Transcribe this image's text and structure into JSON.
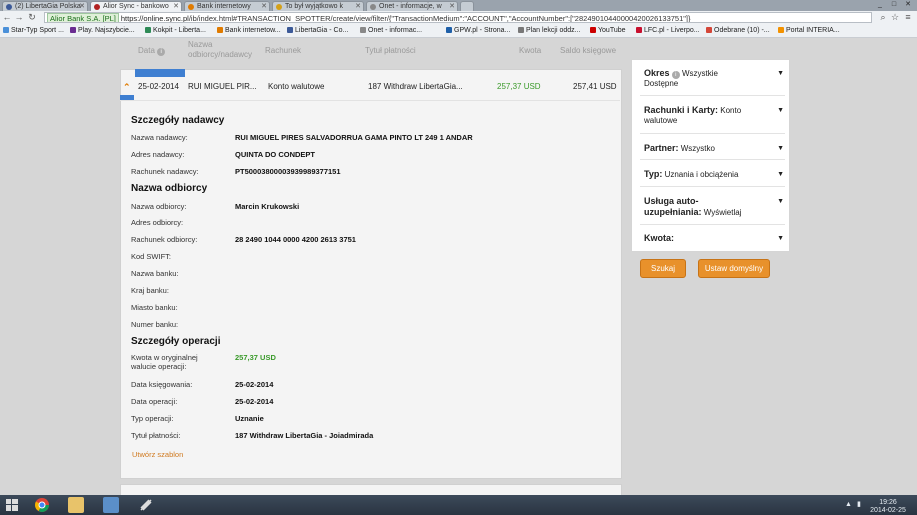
{
  "browser": {
    "tabs": [
      {
        "title": "(2) LibertaGia Polska",
        "color": "#3b5998"
      },
      {
        "title": "Alior Sync - bankowo",
        "color": "#b22222"
      },
      {
        "title": "Bank internetowy",
        "color": "#e07b00"
      },
      {
        "title": "To był wyjątkowo k",
        "color": "#d4a017"
      },
      {
        "title": "Onet - informacje, w",
        "color": "#888888"
      }
    ],
    "window_controls": [
      "_",
      "□",
      "✕"
    ],
    "url_secure": "Alior Bank S.A. [PL]",
    "url_host": "https://online.sync.pl",
    "url_path": "/ib/index.html#TRANSACTION_SPOTTER/create/view/filter/{\"TransactionMedium\":\"ACCOUNT\",\"AccountNumber\":[\"28249010440000420026133751\"]}",
    "bookmarks": [
      {
        "label": "Star-Typ Sport ...",
        "color": "#4a90d9"
      },
      {
        "label": "Play. Najszybcie...",
        "color": "#6a2c91"
      },
      {
        "label": "Kokpit - Liberta...",
        "color": "#2e8b57"
      },
      {
        "label": "Bank internetow...",
        "color": "#e07b00"
      },
      {
        "label": "LibertaGia - Co...",
        "color": "#3b5998"
      },
      {
        "label": "Onet - informac...",
        "color": "#888888"
      },
      {
        "label": "GPW.pl - Strona...",
        "color": "#1e5fa8"
      },
      {
        "label": "Plan lekcji oddz...",
        "color": "#777777"
      },
      {
        "label": "YouTube",
        "color": "#cc0000"
      },
      {
        "label": "LFC.pl - Liverpo...",
        "color": "#c8102e"
      },
      {
        "label": "Odebrane (10) -...",
        "color": "#d44638"
      },
      {
        "label": "Portal INTERIA...",
        "color": "#f39200"
      }
    ]
  },
  "table": {
    "headers": {
      "date": "Data",
      "counterparty": "Nazwa odbiorcy/nadawcy",
      "account": "Rachunek",
      "title": "Tytuł płatności",
      "amount": "Kwota",
      "balance": "Saldo księgowe"
    },
    "row": {
      "date": "25-02-2014",
      "counterparty": "RUI MIGUEL PIR...",
      "account": "Konto walutowe",
      "title": "187 Withdraw LibertaGia...",
      "amount": "257,37 USD",
      "balance": "257,41 USD"
    }
  },
  "details": {
    "sender_heading": "Szczegóły nadawcy",
    "sender": [
      {
        "label": "Nazwa nadawcy:",
        "value": "RUI MIGUEL PIRES SALVADORRUA GAMA PINTO LT 249 1 ANDAR"
      },
      {
        "label": "Adres nadawcy:",
        "value": "QUINTA DO CONDEPT"
      },
      {
        "label": "Rachunek nadawcy:",
        "value": "PT50003800003939989377151"
      }
    ],
    "recipient_heading": "Nazwa odbiorcy",
    "recipient": [
      {
        "label": "Nazwa odbiorcy:",
        "value": "Marcin Krukowski"
      },
      {
        "label": "Adres odbiorcy:",
        "value": ""
      },
      {
        "label": "Rachunek odbiorcy:",
        "value": "28 2490 1044 0000 4200 2613 3751"
      },
      {
        "label": "Kod SWIFT:",
        "value": ""
      },
      {
        "label": "Nazwa banku:",
        "value": ""
      },
      {
        "label": "Kraj banku:",
        "value": ""
      },
      {
        "label": "Miasto banku:",
        "value": ""
      },
      {
        "label": "Numer banku:",
        "value": ""
      }
    ],
    "operation_heading": "Szczegóły operacji",
    "operation": {
      "amount_label_1": "Kwota w oryginalnej",
      "amount_label_2": "walucie operacji:",
      "amount_value": "257,37 USD",
      "rows": [
        {
          "label": "Data księgowania:",
          "value": "25-02-2014"
        },
        {
          "label": "Data operacji:",
          "value": "25-02-2014"
        },
        {
          "label": "Typ operacji:",
          "value": "Uznanie"
        },
        {
          "label": "Tytuł płatności:",
          "value": "187 Withdraw LibertaGia - Joiadmirada"
        }
      ]
    },
    "template_link": "Utwórz szablon"
  },
  "filters": [
    {
      "name": "Okres",
      "value_1": "Wszystkie",
      "value_2": "Dostępne",
      "info": true
    },
    {
      "name": "Rachunki i Karty:",
      "value_1": "Konto",
      "value_2": "walutowe"
    },
    {
      "name": "Partner:",
      "value_1": "Wszystko",
      "value_2": ""
    },
    {
      "name": "Typ:",
      "value_1": "Uznania i obciążenia",
      "value_2": ""
    },
    {
      "name": "Usługa auto-",
      "name_2": "uzupełniania:",
      "value_1": "Wyświetlaj",
      "value_2": ""
    },
    {
      "name": "Kwota:",
      "value_1": "",
      "value_2": ""
    }
  ],
  "buttons": {
    "search": "Szukaj",
    "default": "Ustaw domyślny"
  },
  "taskbar": {
    "time": "19:26",
    "date": "2014-02-25"
  }
}
